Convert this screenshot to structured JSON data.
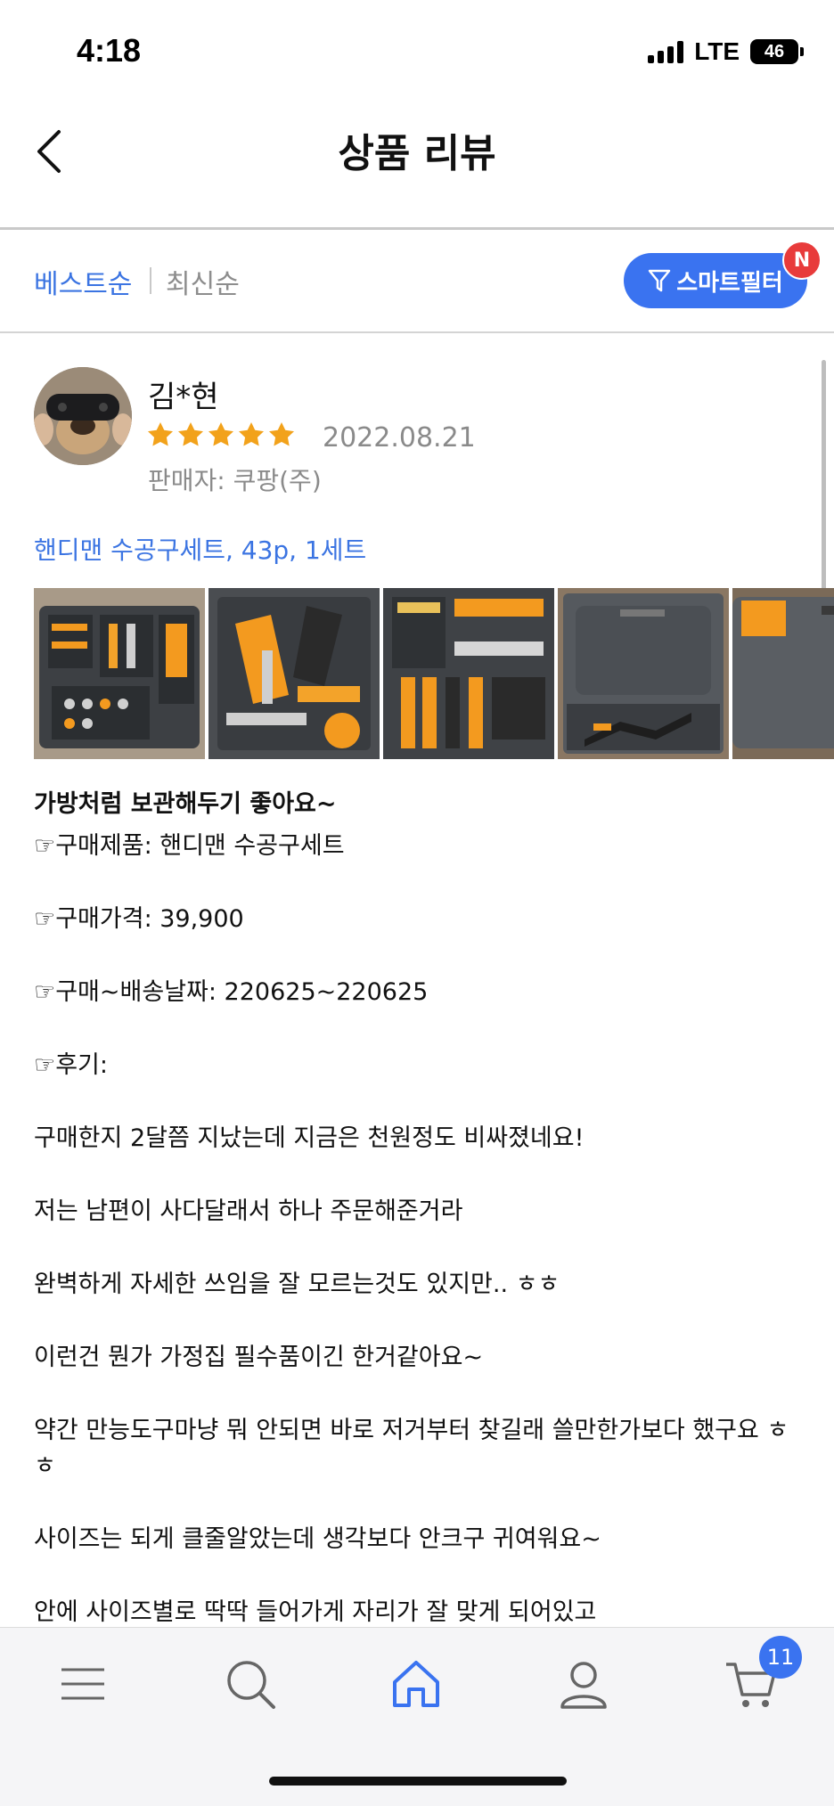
{
  "status_bar": {
    "time": "4:18",
    "network": "LTE",
    "battery": "46"
  },
  "header": {
    "title": "상품 리뷰"
  },
  "sort": {
    "best": "베스트순",
    "newest": "최신순",
    "filter_label": "스마트필터",
    "filter_badge": "N"
  },
  "review": {
    "reviewer_name": "김*현",
    "rating": 5,
    "date": "2022.08.21",
    "seller": "판매자: 쿠팡(주)",
    "product_option": "핸디맨 수공구세트, 43p, 1세트",
    "photo_count_visible": 5,
    "title": "가방처럼 보관해두기 좋아요~",
    "body": [
      "☞구매제품: 핸디맨 수공구세트",
      "☞구매가격: 39,900",
      "☞구매~배송날짜: 220625~220625",
      "☞후기:",
      "구매한지 2달쯤 지났는데 지금은 천원정도 비싸졌네요!",
      "저는 남편이 사다달래서 하나 주문해준거라",
      "완벽하게 자세한 쓰임을 잘 모르는것도 있지만.. ㅎㅎ",
      "이런건 뭔가 가정집 필수품이긴 한거같아요~",
      "약간 만능도구마냥 뭐 안되면 바로 저거부터 찾길래 쓸만한가보다 했구요 ㅎㅎ",
      "사이즈는 되게 클줄알았는데 생각보다 안크구 귀여워요~",
      "안에 사이즈별로 딱딱 들어가게 자리가 잘 맞게 되어있고"
    ]
  },
  "bottom_nav": {
    "items": [
      "menu-icon",
      "search-icon",
      "home-icon",
      "profile-icon",
      "cart-icon"
    ],
    "cart_count": "11",
    "active": "home"
  },
  "colors": {
    "accent": "#3a73f0",
    "link": "#3b74e2",
    "star": "#f2a21b",
    "badge_red": "#e83b3b"
  }
}
